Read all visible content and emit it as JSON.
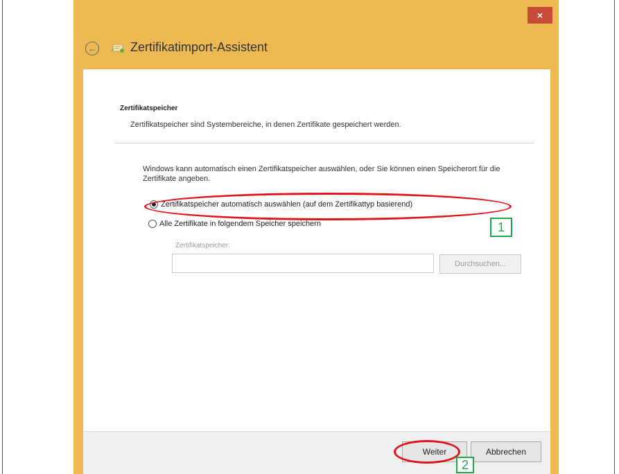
{
  "window": {
    "title": "Zertifikatimport-Assistent",
    "close_glyph": "×"
  },
  "page": {
    "heading": "Zertifikatspeicher",
    "description": "Zertifikatspeicher sind Systembereiche, in denen Zertifikate gespeichert werden.",
    "intro": "Windows kann automatisch einen Zertifikatspeicher auswählen, oder Sie können einen Speicherort für die Zertifikate angeben.",
    "options": [
      {
        "label": "Zertifikatspeicher automatisch auswählen (auf dem Zertifikattyp basierend)",
        "selected": true
      },
      {
        "label": "Alle Zertifikate in folgendem Speicher speichern",
        "selected": false
      }
    ],
    "store_label": "Zertifikatspeicher:",
    "store_value": "",
    "browse_label": "Durchsuchen..."
  },
  "footer": {
    "next_label": "Weiter",
    "cancel_label": "Abbrechen"
  },
  "annotations": {
    "callout_1": "1",
    "callout_2": "2"
  },
  "colors": {
    "title_bar": "#ecb953",
    "close_button": "#c84b3a",
    "highlight_ellipse": "#e0141b",
    "callout_green": "#1ea84b"
  },
  "icons": [
    "back-arrow-icon",
    "certificate-icon",
    "close-icon"
  ]
}
